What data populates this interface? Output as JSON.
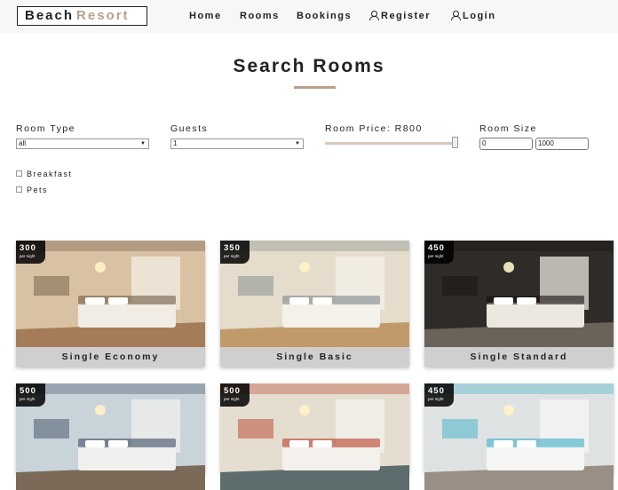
{
  "brand": {
    "word1": "Beach",
    "word2": "Resort"
  },
  "nav": {
    "home": "Home",
    "rooms": "Rooms",
    "bookings": "Bookings",
    "register": "Register",
    "login": "Login"
  },
  "page_title": "Search Rooms",
  "filters": {
    "room_type_label": "Room Type",
    "room_type_value": "all",
    "guests_label": "Guests",
    "guests_value": "1",
    "price_label": "Room Price: R800",
    "price_fill_fraction": 1.0,
    "size_label": "Room Size",
    "size_min": "0",
    "size_max": "1000",
    "breakfast_label": "Breakfast",
    "pets_label": "Pets"
  },
  "price_unit": "per night",
  "rooms": [
    {
      "name": "Single Economy",
      "price": "300",
      "palette": [
        "#d9c2a3",
        "#a47c57",
        "#f1ede4",
        "#6f5a46"
      ]
    },
    {
      "name": "Single Basic",
      "price": "350",
      "palette": [
        "#e6dccb",
        "#c09a6b",
        "#f4f1ea",
        "#7d8a8c"
      ]
    },
    {
      "name": "Single Standard",
      "price": "450",
      "palette": [
        "#2e2b29",
        "#6b625a",
        "#ece7df",
        "#17130f"
      ]
    },
    {
      "name": "",
      "price": "500",
      "palette": [
        "#c9d3da",
        "#7b6a58",
        "#f0f0ee",
        "#3e4f63"
      ]
    },
    {
      "name": "",
      "price": "500",
      "palette": [
        "#e4ddd0",
        "#5d6d6e",
        "#f4f1ec",
        "#b8432c"
      ]
    },
    {
      "name": "",
      "price": "450",
      "palette": [
        "#dfe2e3",
        "#9a8f85",
        "#f6f6f4",
        "#3fb1c6"
      ]
    }
  ]
}
